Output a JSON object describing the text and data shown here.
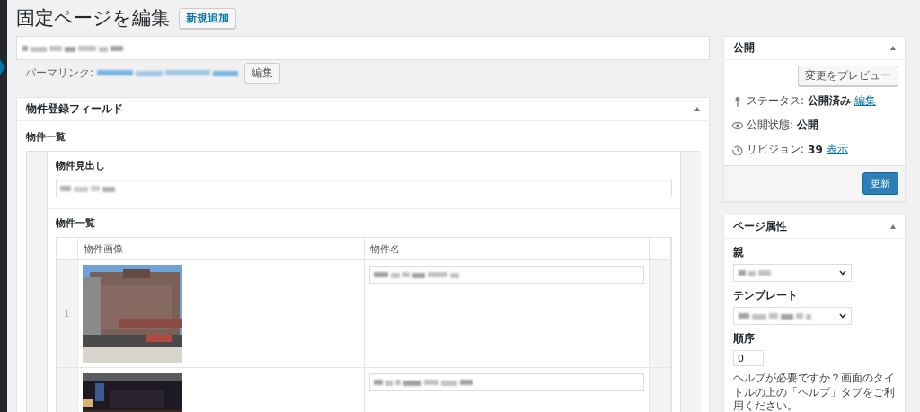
{
  "page_title": "固定ページを編集",
  "add_new_button": "新規追加",
  "permalink": {
    "label": "パーマリンク:",
    "edit_button": "編集"
  },
  "property_box": {
    "title": "物件登録フィールド",
    "expanded": true,
    "section_label": "物件一覧",
    "heading_field": {
      "label": "物件見出し"
    },
    "list": {
      "label": "物件一覧",
      "columns": [
        "物件画像",
        "物件名"
      ],
      "rows": [
        {
          "number": "1",
          "image": {
            "kind": "picture"
          }
        },
        {
          "image": {
            "kind": "picture"
          }
        }
      ]
    }
  },
  "publish_box": {
    "title": "公開",
    "expanded": true,
    "preview_button": "変更をプレビュー",
    "rows": [
      {
        "kind": "status",
        "label": "ステータス:",
        "value": "公開済み",
        "link": "編集"
      },
      {
        "kind": "visibility",
        "label": "公開状態:",
        "value": "公開"
      },
      {
        "kind": "revisions",
        "label": "リビジョン:",
        "value": "39",
        "link": "表示"
      }
    ],
    "update_button": "更新"
  },
  "attributes_box": {
    "title": "ページ属性",
    "expanded": true,
    "parent_label": "親",
    "template_label": "テンプレート",
    "order_label": "順序",
    "order_value": "0",
    "help": "ヘルプが必要ですか？画面のタイトルの上の「ヘルプ」タブをご利用ください。"
  }
}
